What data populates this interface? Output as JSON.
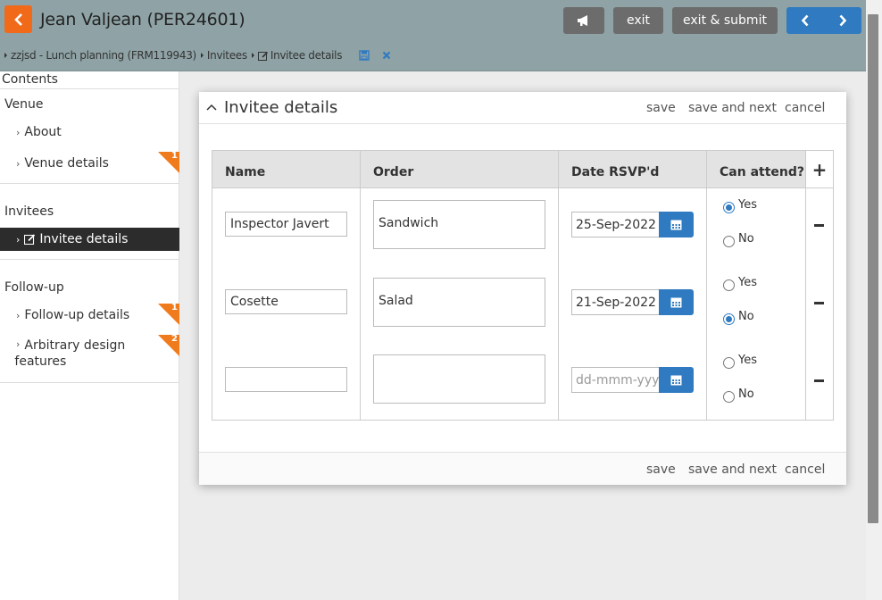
{
  "header": {
    "title": "Jean Valjean (PER24601)",
    "exit_label": "exit",
    "exit_submit_label": "exit & submit"
  },
  "breadcrumb": {
    "items": [
      "zzjsd - Lunch planning (FRM119943)",
      "Invitees",
      "Invitee details"
    ]
  },
  "sidebar": {
    "contents_label": "Contents",
    "sections": [
      {
        "label": "Venue",
        "items": [
          {
            "label": "About",
            "badge": ""
          },
          {
            "label": "Venue details",
            "badge": "1"
          }
        ]
      },
      {
        "label": "Invitees",
        "items": [
          {
            "label": "Invitee details",
            "badge": "",
            "active": true
          }
        ]
      },
      {
        "label": "Follow-up",
        "items": [
          {
            "label": "Follow-up details",
            "badge": "1"
          },
          {
            "label": "Arbitrary design",
            "label2": "features",
            "badge": "2"
          }
        ]
      }
    ]
  },
  "panel": {
    "title": "Invitee details",
    "save_label": "save",
    "save_next_label": "save and next",
    "cancel_label": "cancel",
    "columns": [
      "Name",
      "Order",
      "Date RSVP'd",
      "Can attend?"
    ],
    "add_symbol": "+",
    "date_placeholder": "dd-mmm-yyyy",
    "radio_yes": "Yes",
    "radio_no": "No",
    "rows": [
      {
        "name": "Inspector Javert",
        "order": "Sandwich",
        "date": "25-Sep-2022",
        "attend": "Yes"
      },
      {
        "name": "Cosette",
        "order": "Salad",
        "date": "21-Sep-2022",
        "attend": "No"
      },
      {
        "name": "",
        "order": "",
        "date": "",
        "attend": ""
      }
    ]
  },
  "colors": {
    "header_bg": "#8fa3a6",
    "accent_orange": "#f06a1a",
    "primary_blue": "#2f7ac0",
    "active_nav": "#2c2c2c"
  }
}
